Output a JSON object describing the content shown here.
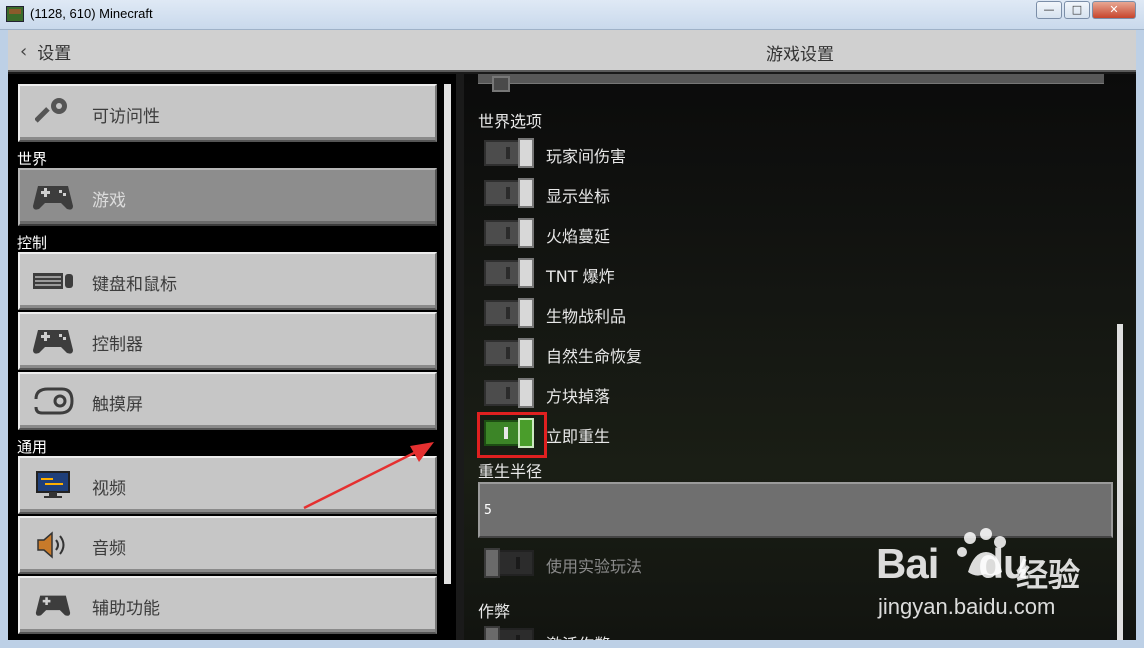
{
  "window": {
    "title": "(1128, 610) Minecraft",
    "minimize": "—",
    "maximize": "□",
    "close": "✕"
  },
  "header": {
    "back_label": "设置",
    "title": "游戏设置"
  },
  "sidebar": {
    "items": [
      {
        "label": "可访问性",
        "icon": "key-icon"
      },
      {
        "label": "游戏",
        "icon": "gamepad-icon",
        "selected": true
      },
      {
        "label": "键盘和鼠标",
        "icon": "keyboard-icon"
      },
      {
        "label": "控制器",
        "icon": "controller-icon"
      },
      {
        "label": "触摸屏",
        "icon": "touch-icon"
      },
      {
        "label": "视频",
        "icon": "monitor-icon"
      },
      {
        "label": "音频",
        "icon": "speaker-icon"
      },
      {
        "label": "辅助功能",
        "icon": "controller-icon"
      }
    ],
    "sections": {
      "world": "世界",
      "controls": "控制",
      "general": "通用"
    }
  },
  "main": {
    "world_options_heading": "世界选项",
    "toggles": [
      {
        "label": "玩家间伤害",
        "on": false
      },
      {
        "label": "显示坐标",
        "on": false
      },
      {
        "label": "火焰蔓延",
        "on": false
      },
      {
        "label": "TNT 爆炸",
        "on": false
      },
      {
        "label": "生物战利品",
        "on": false
      },
      {
        "label": "自然生命恢复",
        "on": false
      },
      {
        "label": "方块掉落",
        "on": false
      },
      {
        "label": "立即重生",
        "on": true
      }
    ],
    "respawn_radius_label": "重生半径",
    "respawn_radius_value": "5",
    "experimental_label": "使用实验玩法",
    "cheats_heading": "作弊",
    "activate_cheats_label": "激活作弊"
  },
  "watermark": {
    "logo": "Bai",
    "logo_suffix": "du",
    "brand": "经验",
    "url": "jingyan.baidu.com"
  },
  "colors": {
    "toggle_on": "#3c8527",
    "highlight": "#e02020",
    "button_bg": "#c6c6c6"
  }
}
